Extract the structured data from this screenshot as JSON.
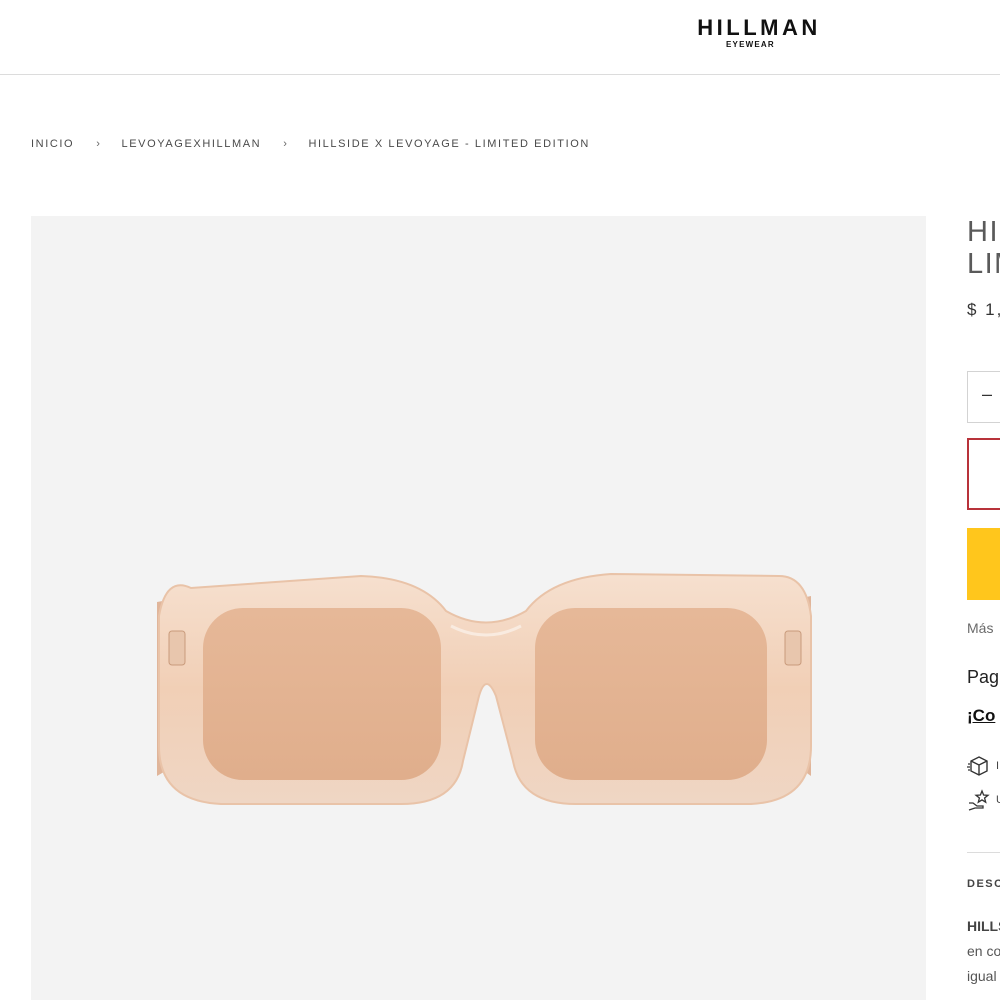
{
  "header": {
    "logo_main": "HILLMAN",
    "logo_sub": "EYEWEAR"
  },
  "breadcrumb": {
    "items": [
      "INICIO",
      "LEVOYAGEXHILLMAN",
      "HILLSIDE X LEVOYAGE - LIMITED EDITION"
    ],
    "separator": "›"
  },
  "gallery": {
    "image_name": "sunglasses-product-image",
    "frame_color": "#f3d5c0",
    "lens_color": "#e4b492",
    "background_color": "#f3f3f3"
  },
  "product": {
    "title_line_1": "HI",
    "title_line_2": "LIM",
    "price": "$ 1,",
    "quantity_minus": "–",
    "more_text": "Más",
    "pay_text": "Pag",
    "com_link": "¡Co",
    "feature_1_text": "I",
    "feature_2_text": "U",
    "description_heading": "DESC",
    "description_lines": [
      "HILLS",
      "en co",
      "igual"
    ]
  },
  "colors": {
    "accent_yellow": "#ffc61c",
    "outline_red": "#b8323a"
  }
}
